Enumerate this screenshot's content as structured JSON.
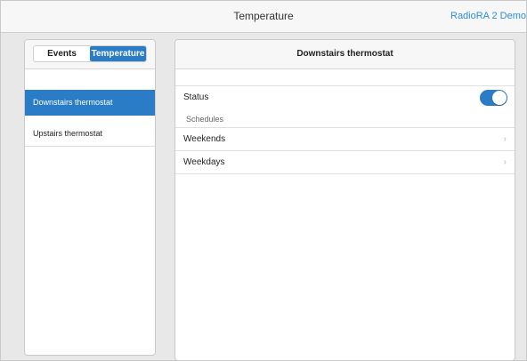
{
  "header": {
    "title": "Temperature",
    "right_label": "RadioRA 2 Demo"
  },
  "sidebar": {
    "segments": [
      {
        "label": "Events",
        "active": false
      },
      {
        "label": "Temperature",
        "active": true
      }
    ],
    "items": [
      {
        "label": "Downstairs thermostat",
        "selected": true
      },
      {
        "label": "Upstairs thermostat",
        "selected": false
      }
    ]
  },
  "detail": {
    "title": "Downstairs thermostat",
    "status_label": "Status",
    "status_on": true,
    "schedules_label": "Schedules",
    "schedules": [
      {
        "label": "Weekends",
        "chevron": "chevron-right-icon"
      },
      {
        "label": "Weekdays",
        "chevron": "chevron-right-icon"
      }
    ]
  },
  "colors": {
    "accent": "#2a7cc7",
    "link": "#2b8de0"
  }
}
